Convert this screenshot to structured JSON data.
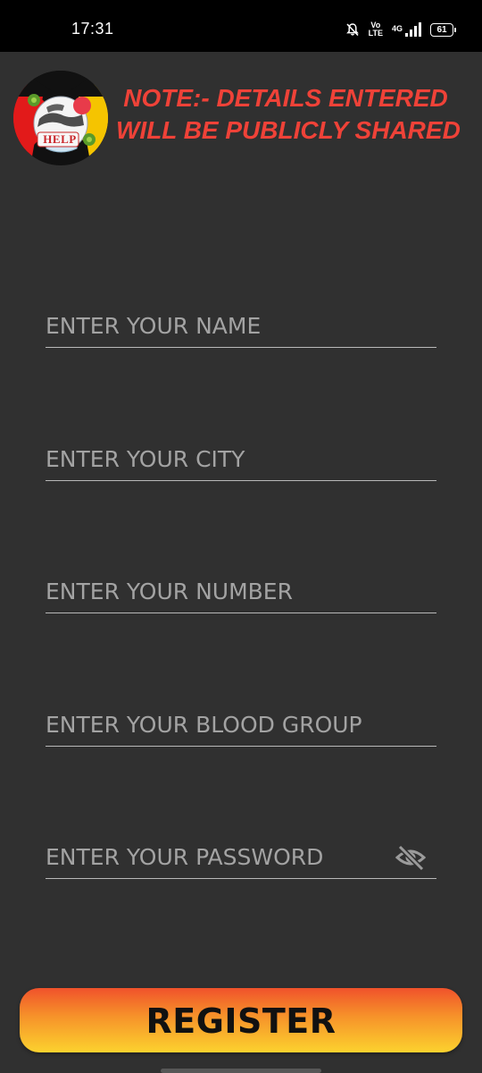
{
  "status_bar": {
    "time": "17:31",
    "volte_top": "Vo",
    "volte_bottom": "LTE",
    "network": "4G",
    "battery": "61",
    "icons": [
      "mute-bell-icon",
      "volte-icon",
      "signal-icon",
      "battery-icon"
    ]
  },
  "header": {
    "logo_icon": "help-covid-logo",
    "logo_text": "HELP",
    "note_line1": "NOTE:- DETAILS ENTERED",
    "note_line2": "WILL BE PUBLICLY SHARED"
  },
  "form": {
    "name_placeholder": "ENTER YOUR NAME",
    "city_placeholder": "ENTER YOUR CITY",
    "number_placeholder": "ENTER YOUR NUMBER",
    "blood_group_placeholder": "ENTER YOUR BLOOD GROUP",
    "password_placeholder": "ENTER YOUR PASSWORD",
    "password_toggle_icon": "eye-off-icon"
  },
  "register_label": "REGISTER",
  "colors": {
    "background": "#303030",
    "note_red": "#ef4238",
    "button_top": "#f0522b",
    "button_bottom": "#fcd22e"
  }
}
